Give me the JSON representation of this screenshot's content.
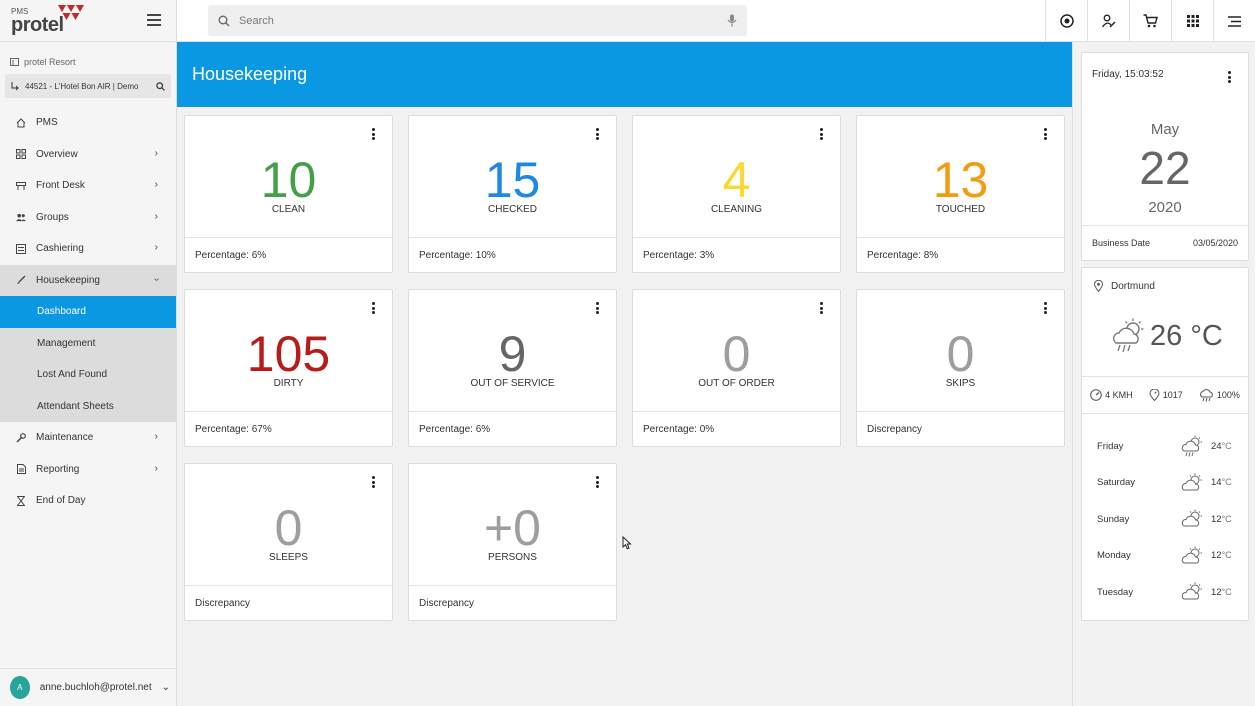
{
  "app": {
    "logo_small": "PMS",
    "logo_word": "protel",
    "property": "protel Resort",
    "hotel": "44521 - L'Hotel  Bon AIR | Demo"
  },
  "search": {
    "placeholder": "Search"
  },
  "nav": {
    "items": [
      {
        "label": "PMS"
      },
      {
        "label": "Overview"
      },
      {
        "label": "Front Desk"
      },
      {
        "label": "Groups"
      },
      {
        "label": "Cashiering"
      },
      {
        "label": "Housekeeping"
      },
      {
        "label": "Maintenance"
      },
      {
        "label": "Reporting"
      },
      {
        "label": "End of Day"
      }
    ],
    "housekeeping_sub": [
      {
        "label": "Dashboard"
      },
      {
        "label": "Management"
      },
      {
        "label": "Lost And Found"
      },
      {
        "label": "Attendant Sheets"
      }
    ]
  },
  "user": {
    "initial": "A",
    "email": "anne.buchloh@protel.net"
  },
  "page": {
    "title": "Housekeeping"
  },
  "tiles": [
    {
      "value": "10",
      "label": "CLEAN",
      "footer": "Percentage:  6%",
      "color": "#43a047"
    },
    {
      "value": "15",
      "label": "CHECKED",
      "footer": "Percentage:  10%",
      "color": "#1e88e5"
    },
    {
      "value": "4",
      "label": "CLEANING",
      "footer": "Percentage:  3%",
      "color": "#fdd835"
    },
    {
      "value": "13",
      "label": "TOUCHED",
      "footer": "Percentage:  8%",
      "color": "#f39c12"
    },
    {
      "value": "105",
      "label": "DIRTY",
      "footer": "Percentage:  67%",
      "color": "#b71c1c"
    },
    {
      "value": "9",
      "label": "OUT OF SERVICE",
      "footer": "Percentage:  6%",
      "color": "#666666"
    },
    {
      "value": "0",
      "label": "OUT OF ORDER",
      "footer": "Percentage:  0%",
      "color": "#9e9e9e"
    },
    {
      "value": "0",
      "label": "SKIPS",
      "footer": "Discrepancy",
      "color": "#9e9e9e"
    },
    {
      "value": "0",
      "label": "SLEEPS",
      "footer": "Discrepancy",
      "color": "#9e9e9e"
    },
    {
      "value": "+0",
      "label": "PERSONS",
      "footer": "Discrepancy",
      "color": "#9e9e9e"
    }
  ],
  "date_card": {
    "time": "Friday, 15:03:52",
    "month": "May",
    "day": "22",
    "year": "2020",
    "business_date_label": "Business Date",
    "business_date": "03/05/2020"
  },
  "weather": {
    "city": "Dortmund",
    "temperature": "26 °C",
    "wind": "4 KMH",
    "pressure": "1017",
    "humidity": "100%",
    "forecast": [
      {
        "day": "Friday",
        "temp": "24",
        "unit": "°C",
        "icon": "rain-cloud-sun-icon"
      },
      {
        "day": "Saturday",
        "temp": "14",
        "unit": "°C",
        "icon": "cloud-sun-icon"
      },
      {
        "day": "Sunday",
        "temp": "12",
        "unit": "°C",
        "icon": "cloud-sun-icon"
      },
      {
        "day": "Monday",
        "temp": "12",
        "unit": "°C",
        "icon": "cloud-sun-icon"
      },
      {
        "day": "Tuesday",
        "temp": "12",
        "unit": "°C",
        "icon": "cloud-sun-icon"
      }
    ]
  },
  "colors": {
    "accent": "#0b98e3",
    "avatar": "#26a69a"
  }
}
